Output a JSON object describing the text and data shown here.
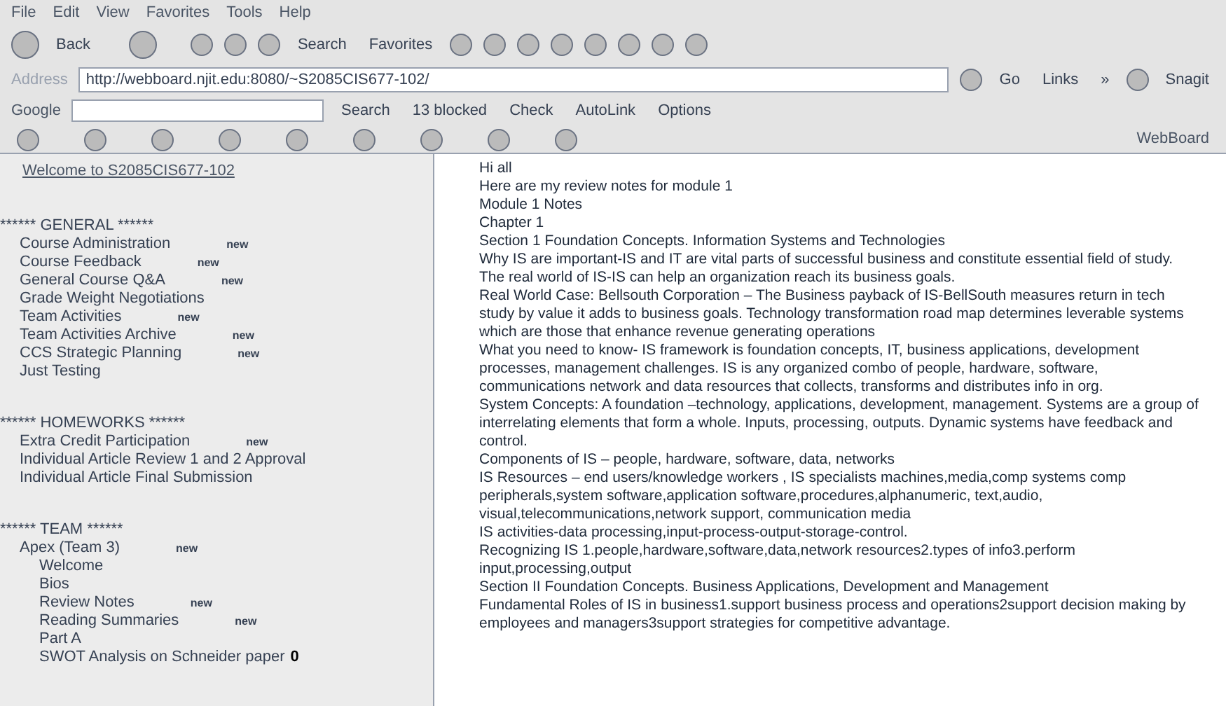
{
  "menu_bar": [
    "File",
    "Edit",
    "View",
    "Favorites",
    "Tools",
    "Help"
  ],
  "toolbar": {
    "back": "Back",
    "search": "Search",
    "favorites": "Favorites"
  },
  "address_bar": {
    "label": "Address",
    "url": "http://webboard.njit.edu:8080/~S2085CIS677-102/",
    "go": "Go",
    "links": "Links",
    "more": "»",
    "snagit": "Snagit"
  },
  "google_bar": {
    "logo": "Google",
    "search": "Search",
    "blocked": "13 blocked",
    "check": "Check",
    "autolink": "AutoLink",
    "options": "Options"
  },
  "webboard_bar": {
    "label": "WebBoard"
  },
  "sidebar": {
    "welcome": "Welcome to S2085CIS677-102",
    "sections": [
      {
        "title": "****** GENERAL ******",
        "items": [
          {
            "label": "Course Administration",
            "badge": "new"
          },
          {
            "label": "Course Feedback",
            "badge": "new"
          },
          {
            "label": "General Course Q&A",
            "badge": "new"
          },
          {
            "label": "Grade Weight Negotiations"
          },
          {
            "label": "Team Activities",
            "badge": "new"
          },
          {
            "label": "Team Activities Archive",
            "badge": "new"
          },
          {
            "label": "CCS Strategic Planning",
            "badge": "new"
          },
          {
            "label": "Just Testing"
          }
        ]
      },
      {
        "title": "****** HOMEWORKS ******",
        "items": [
          {
            "label": "Extra Credit Participation",
            "badge": "new"
          },
          {
            "label": "Individual Article Review 1 and 2 Approval"
          },
          {
            "label": "Individual Article Final Submission"
          }
        ]
      },
      {
        "title": "****** TEAM ******",
        "items": [
          {
            "label": "Apex (Team 3)",
            "badge": "new",
            "children": [
              {
                "label": "Welcome"
              },
              {
                "label": "Bios"
              },
              {
                "label": "Review Notes",
                "badge": "new"
              },
              {
                "label": "Reading Summaries",
                "badge": "new"
              },
              {
                "label": "Part A"
              },
              {
                "label": "SWOT Analysis on Schneider paper",
                "count": "0"
              }
            ]
          }
        ]
      }
    ]
  },
  "message": [
    "Hi all",
    "Here are my review notes for module 1",
    "Module 1 Notes",
    "Chapter 1",
    "Section 1 Foundation Concepts. Information Systems and Technologies",
    "Why IS are important-IS and IT are vital parts of successful business and constitute essential field of study.",
    "The real world of IS-IS can help an organization reach its business goals.",
    "Real World Case: Bellsouth Corporation – The Business payback of IS-BellSouth measures return in tech study by value it adds to business goals. Technology transformation road map determines leverable systems which are those that enhance revenue generating operations",
    "What you need to know- IS framework is foundation concepts, IT, business applications, development processes, management challenges. IS is any organized combo of people, hardware, software, communications network and data resources that collects, transforms and distributes info in org.",
    "System Concepts: A foundation –technology, applications, development, management. Systems are a group of interrelating elements that form a whole. Inputs, processing, outputs. Dynamic systems have feedback and control.",
    "Components of IS – people, hardware, software, data, networks",
    "IS Resources – end users/knowledge workers , IS specialists machines,media,comp systems comp peripherals,system software,application software,procedures,alphanumeric, text,audio, visual,telecommunications,network support, communication media",
    "IS activities-data processing,input-process-output-storage-control.",
    "Recognizing IS 1.people,hardware,software,data,network resources2.types of info3.perform input,processing,output",
    "Section II Foundation Concepts. Business Applications, Development and Management",
    "Fundamental Roles of IS in business1.support business process and operations2support decision making by employees and managers3support strategies for competitive advantage."
  ]
}
